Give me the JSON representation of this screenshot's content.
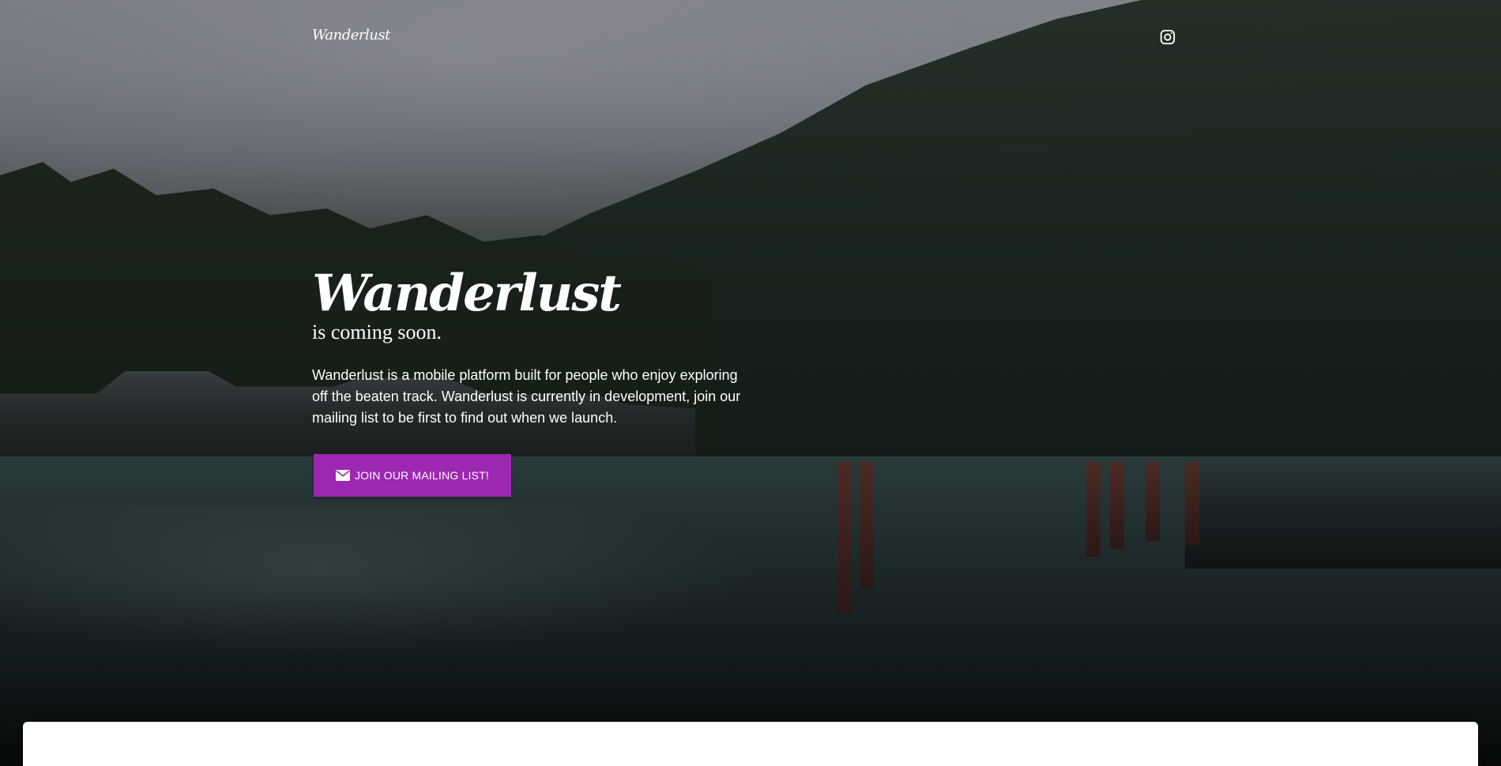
{
  "nav": {
    "brand": "Wanderlust",
    "instagram_icon": "instagram-icon"
  },
  "hero": {
    "title": "Wanderlust",
    "subtitle": "is coming soon.",
    "description": "Wanderlust is a mobile platform built for people who enjoy exploring off the beaten track. Wanderlust is currently in development, join our mailing list to be first to find out when we launch.",
    "cta_label": "JOIN OUR MAILING LIST!",
    "cta_icon": "envelope-icon"
  },
  "colors": {
    "accent": "#9c27b0",
    "text": "#ffffff"
  }
}
